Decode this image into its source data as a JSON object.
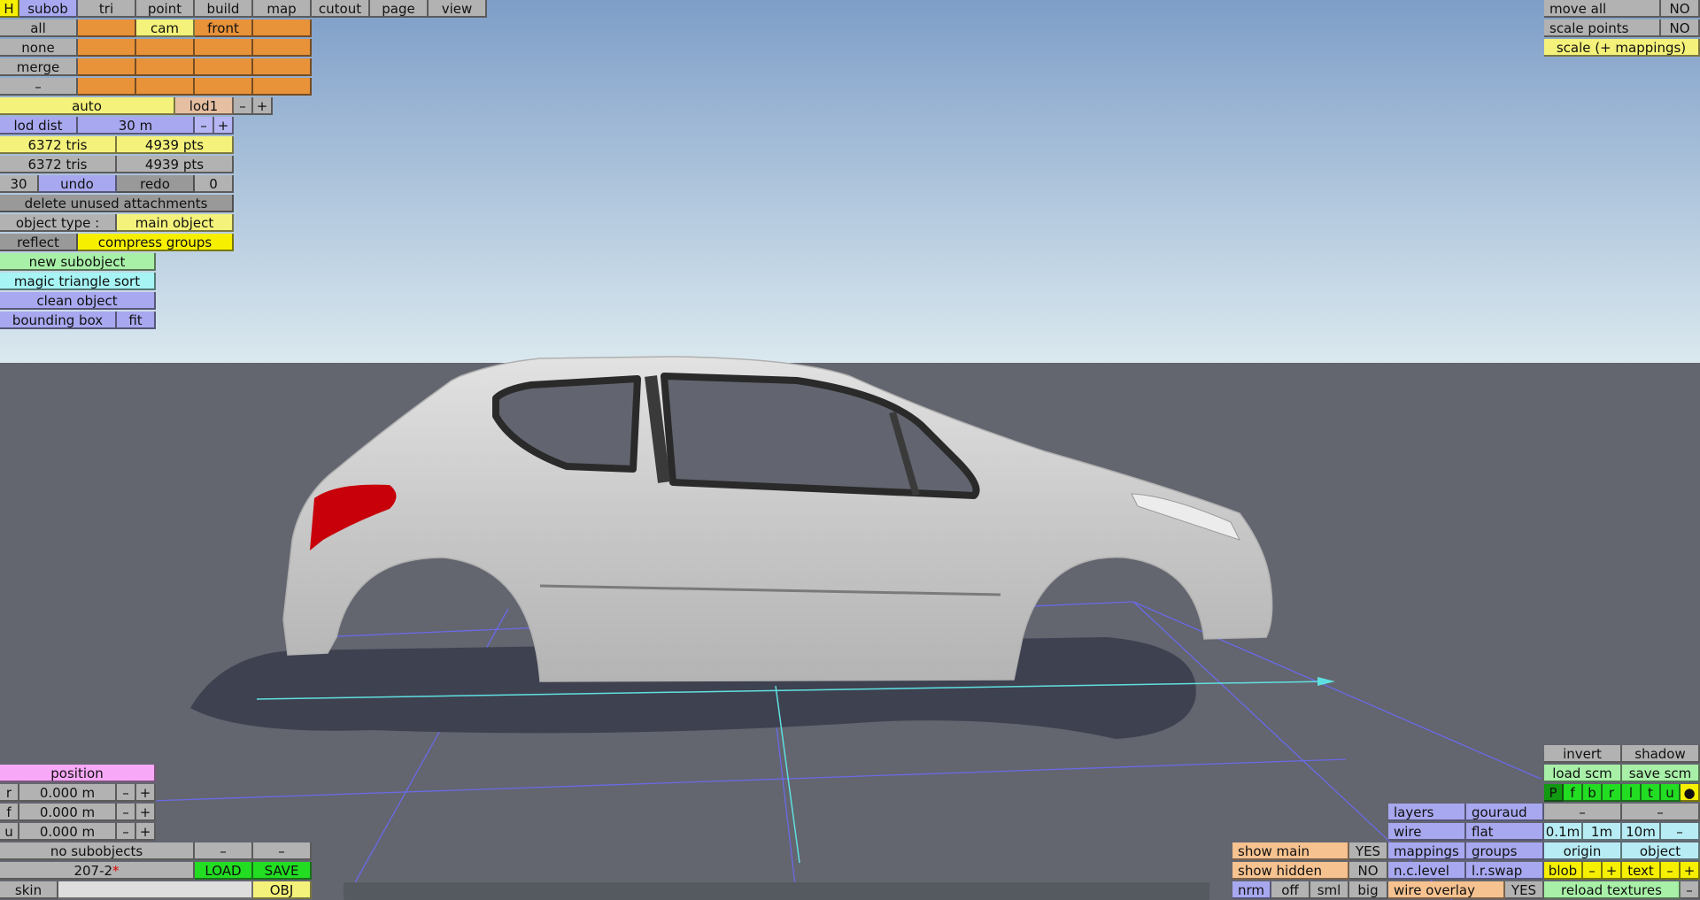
{
  "top_menu": {
    "h": "H",
    "subob": "subob",
    "tri": "tri",
    "point": "point",
    "build": "build",
    "map": "map",
    "cutout": "cutout",
    "page": "page",
    "view": "view"
  },
  "select": {
    "all": "all",
    "none": "none",
    "merge": "merge",
    "minus": "–",
    "cam": "cam",
    "front": "front"
  },
  "lod": {
    "auto": "auto",
    "level": "lod1",
    "minus": "–",
    "plus": "+",
    "dist_label": "lod dist",
    "dist_value": "30 m",
    "dist_minus": "–",
    "dist_plus": "+"
  },
  "stats": {
    "tris1": "6372 tris",
    "pts1": "4939 pts",
    "tris2": "6372 tris",
    "pts2": "4939 pts"
  },
  "history": {
    "undo_count": "30",
    "undo": "undo",
    "redo": "redo",
    "redo_count": "0"
  },
  "object": {
    "delete_unused": "delete unused attachments",
    "type_label": "object type :",
    "type_value": "main object",
    "reflect": "reflect",
    "compress_groups": "compress groups",
    "new_subobject": "new subobject",
    "magic_sort": "magic triangle sort",
    "clean_object": "clean object",
    "bounding_box": "bounding box",
    "fit": "fit"
  },
  "position": {
    "title": "position",
    "rows": [
      {
        "axis": "r",
        "value": "0.000 m",
        "minus": "–",
        "plus": "+"
      },
      {
        "axis": "f",
        "value": "0.000 m",
        "minus": "–",
        "plus": "+"
      },
      {
        "axis": "u",
        "value": "0.000 m",
        "minus": "–",
        "plus": "+"
      }
    ]
  },
  "file": {
    "no_subobjects": "no subobjects",
    "minus1": "–",
    "minus2": "–",
    "name": "207-2",
    "modified": "*",
    "load": "LOAD",
    "save": "SAVE",
    "skin": "skin",
    "obj": "OBJ"
  },
  "top_right": {
    "move_all": "move all",
    "move_all_value": "NO",
    "scale_points": "scale points",
    "scale_points_value": "NO",
    "scale_mappings": "scale (+ mappings)"
  },
  "view_panel": {
    "invert": "invert",
    "shadow": "shadow",
    "load_scm": "load scm",
    "save_scm": "save scm",
    "view_buttons": [
      "P",
      "f",
      "b",
      "r",
      "l",
      "t",
      "u",
      "●"
    ],
    "layers": "layers",
    "gouraud": "gouraud",
    "dash1": "–",
    "dash2": "–",
    "wire": "wire",
    "flat": "flat",
    "grid_01": "0.1m",
    "grid_1": "1m",
    "grid_10": "10m",
    "grid_minus": "–",
    "show_main": "show main",
    "show_main_value": "YES",
    "mappings": "mappings",
    "groups": "groups",
    "origin": "origin",
    "object": "object",
    "show_hidden": "show hidden",
    "show_hidden_value": "NO",
    "nc_level": "n.c.level",
    "lr_swap": "l.r.swap",
    "blob": "blob",
    "blob_minus": "–",
    "blob_plus": "+",
    "text": "text",
    "text_minus": "–",
    "text_plus": "+",
    "nrm": "nrm",
    "off": "off",
    "sml": "sml",
    "big": "big",
    "wire_overlay": "wire overlay",
    "wire_overlay_value": "YES",
    "reload_textures": "reload textures",
    "reload_minus": "–"
  },
  "colors": {
    "sky_top": "#7f9fc9",
    "sky_bottom": "#d9e8ee",
    "ground": "#63656f",
    "car_body": "#c9c9c9",
    "taillight": "#c8000a",
    "grid": "#6a6ae6",
    "axis": "#5fe0e0"
  }
}
